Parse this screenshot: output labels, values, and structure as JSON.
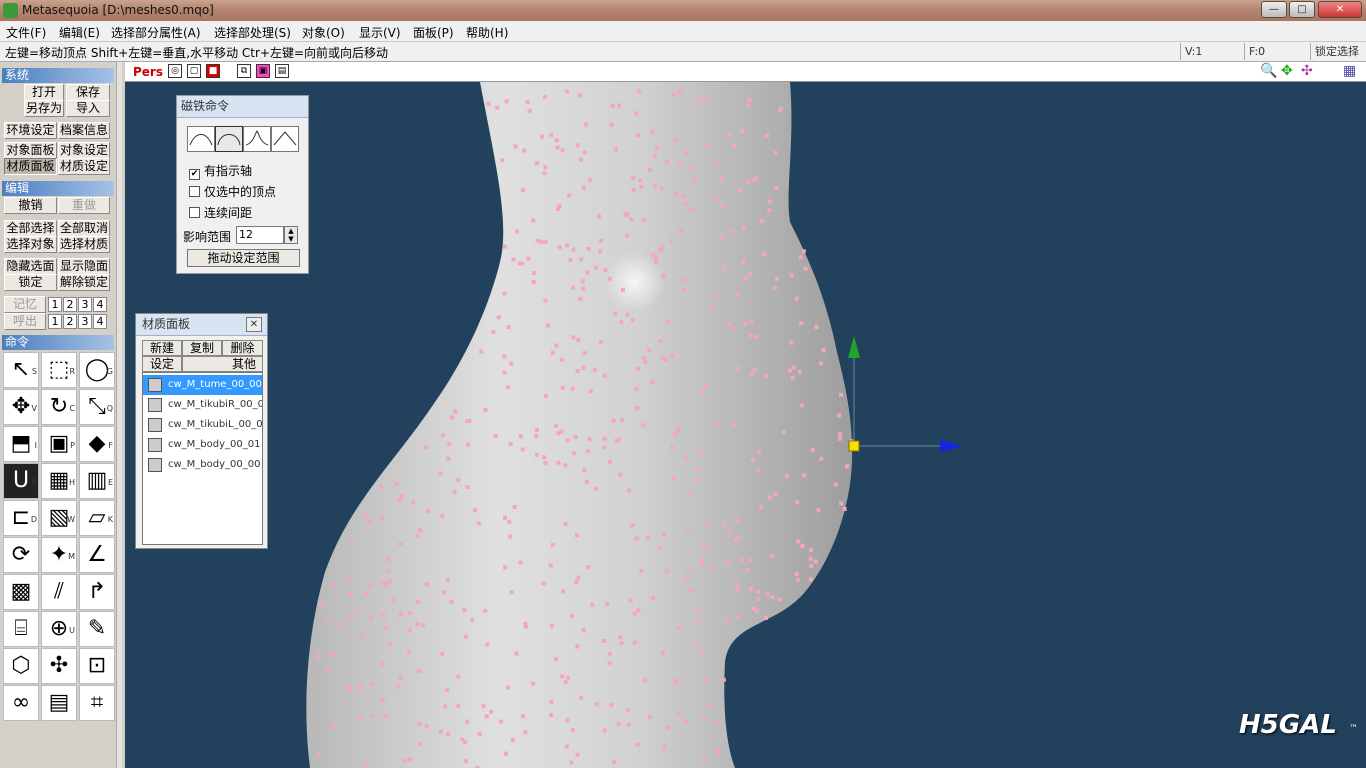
{
  "window": {
    "title": "Metasequoia [D:\\meshes0.mqo]",
    "minimize": "—",
    "maximize": "□",
    "close": "✕"
  },
  "menu": [
    "文件(F)",
    "编辑(E)",
    "选择部分属性(A)",
    "选择部处理(S)",
    "对象(O)",
    "显示(V)",
    "面板(P)",
    "帮助(H)"
  ],
  "status": {
    "hint": "左键=移动顶点 Shift+左键=垂直,水平移动 Ctr+左键=向前或向后移动",
    "v": "V:1",
    "f": "F:0",
    "lock": "锁定选择"
  },
  "sidebar": {
    "system": {
      "title": "系统",
      "open": "打开",
      "save": "保存",
      "saveas": "另存为",
      "import": "导入",
      "env": "环境设定",
      "info": "档案信息",
      "objpanel": "对象面板",
      "objset": "对象设定",
      "matpanel": "材质面板",
      "matset": "材质设定"
    },
    "edit": {
      "title": "编辑",
      "undo": "撤销",
      "redo": "重做",
      "selall": "全部选择",
      "deselall": "全部取消",
      "selobj": "选择对象",
      "selmat": "选择材质",
      "hide": "隐藏选面",
      "show": "显示隐面",
      "lock": "锁定",
      "unlock": "解除锁定",
      "memory": "记忆",
      "recall": "呼出",
      "nums": [
        "1",
        "2",
        "3",
        "4"
      ]
    },
    "commands": {
      "title": "命令",
      "tools": [
        {
          "icon": "↖",
          "key": "S"
        },
        {
          "icon": "⬚",
          "key": "R"
        },
        {
          "icon": "◯",
          "key": "G"
        },
        {
          "icon": "✥",
          "key": "V"
        },
        {
          "icon": "↻",
          "key": "C"
        },
        {
          "icon": "⤡",
          "key": "Q"
        },
        {
          "icon": "⬒",
          "key": "I"
        },
        {
          "icon": "▣",
          "key": "P"
        },
        {
          "icon": "◆",
          "key": "F"
        },
        {
          "icon": "U",
          "key": "B"
        },
        {
          "icon": "▦",
          "key": "H"
        },
        {
          "icon": "▥",
          "key": "E"
        },
        {
          "icon": "⊏",
          "key": "D"
        },
        {
          "icon": "▧",
          "key": "W"
        },
        {
          "icon": "▱",
          "key": "K"
        },
        {
          "icon": "⟳",
          "key": ""
        },
        {
          "icon": "✦",
          "key": "M"
        },
        {
          "icon": "∠",
          "key": ""
        },
        {
          "icon": "▩",
          "key": ""
        },
        {
          "icon": "⫽",
          "key": ""
        },
        {
          "icon": "↱",
          "key": ""
        },
        {
          "icon": "⌸",
          "key": ""
        },
        {
          "icon": "⊕",
          "key": "U"
        },
        {
          "icon": "✎",
          "key": ""
        },
        {
          "icon": "⬡",
          "key": ""
        },
        {
          "icon": "✣",
          "key": ""
        },
        {
          "icon": "⊡",
          "key": ""
        },
        {
          "icon": "∞",
          "key": ""
        },
        {
          "icon": "▤",
          "key": ""
        },
        {
          "icon": "⌗",
          "key": ""
        }
      ]
    }
  },
  "viewport": {
    "mode": "Pers"
  },
  "magnet": {
    "title": "磁铁命令",
    "opt1": "有指示轴",
    "opt2": "仅选中的顶点",
    "opt3": "连续间距",
    "range_label": "影响范围",
    "range_value": "12",
    "drag_btn": "拖动设定范围"
  },
  "materials": {
    "title": "材质面板",
    "new": "新建",
    "copy": "复制",
    "delete": "删除",
    "settings": "设定",
    "other": "其他",
    "items": [
      "cw_M_tume_00_00",
      "cw_M_tikubiR_00_0",
      "cw_M_tikubiL_00_0",
      "cw_M_body_00_01",
      "cw_M_body_00_00"
    ]
  },
  "watermark": "H5GAL",
  "trademark": "™",
  "colors": {
    "accent": "#3399ff",
    "viewport_bg": "#21415c",
    "mesh": "#d8d8d8",
    "vertex": "#f4a6bd"
  }
}
